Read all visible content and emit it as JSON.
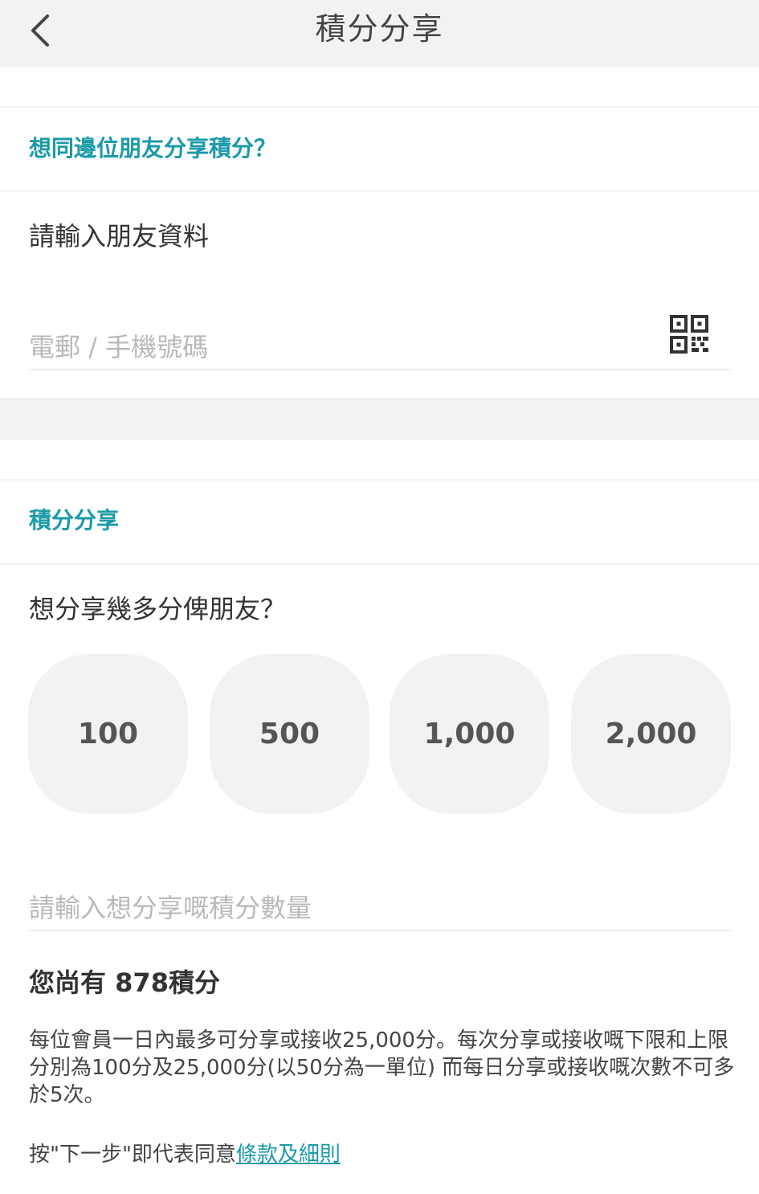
{
  "header": {
    "title": "積分分享",
    "back_icon": "chevron-left-icon"
  },
  "friend_section": {
    "title": "想同邊位朋友分享積分？",
    "prompt": "請輸入朋友資料",
    "contact_placeholder": "電郵 / 手機號碼",
    "contact_value": "",
    "scan_icon": "qr-code-icon"
  },
  "points_section": {
    "title": "積分分享",
    "prompt": "想分享幾多分俾朋友？",
    "amount_options": [
      "100",
      "500",
      "1,000",
      "2,000"
    ],
    "amount_placeholder": "請輸入想分享嘅積分數量",
    "amount_value": "",
    "balance_prefix": "您尚有 ",
    "balance_value": "878",
    "balance_suffix": "積分",
    "notice": "每位會員一日內最多可分享或接收25,000分。每次分享或接收嘅下限和上限分別為100分及25,000分(以50分為一單位) 而每日分享或接收嘅次數不可多於5次。",
    "agree_prefix": "按\"下一步\"即代表同意",
    "terms_link": "條款及細則"
  },
  "colors": {
    "accent": "#1b9aa8",
    "nav_background": "#f2f2f2",
    "button_background": "#f2f2f2"
  }
}
